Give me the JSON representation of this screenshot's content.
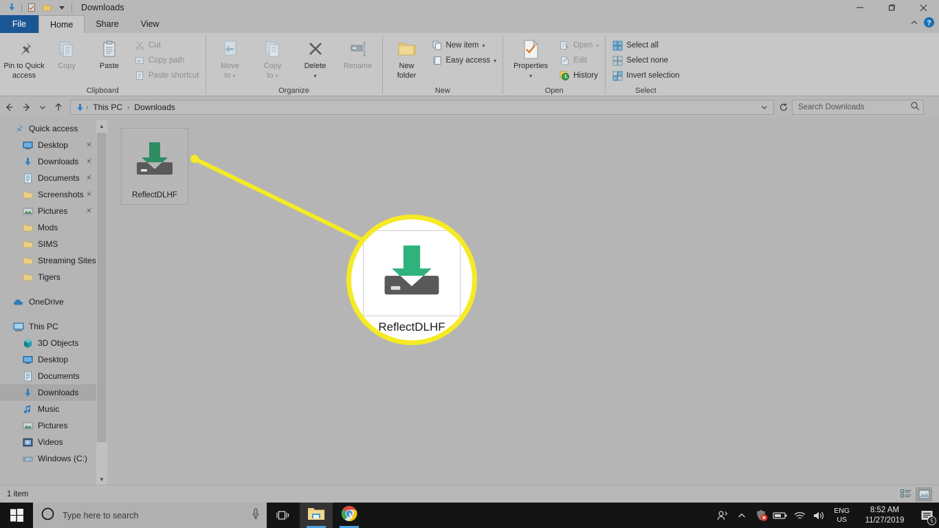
{
  "window": {
    "title": "Downloads",
    "quick_access_icons": [
      "downloads-arrow-icon",
      "properties-check-icon",
      "new-folder-icon",
      "customize-chevron-icon"
    ],
    "controls": {
      "minimize": "minimize-icon",
      "maximize": "maximize-icon",
      "close": "close-icon"
    }
  },
  "ribbon": {
    "tabs": [
      {
        "label": "File",
        "active": false,
        "kind": "file"
      },
      {
        "label": "Home",
        "active": true,
        "kind": "normal"
      },
      {
        "label": "Share",
        "active": false,
        "kind": "normal"
      },
      {
        "label": "View",
        "active": false,
        "kind": "normal"
      }
    ],
    "collapse_icon": "chevron-up-icon",
    "help_icon": "help-icon",
    "groups": [
      {
        "label": "Clipboard",
        "big_buttons": [
          {
            "label": "Pin to Quick\naccess",
            "label_line1": "Pin to Quick",
            "label_line2": "access",
            "icon": "pin-icon",
            "disabled": false
          },
          {
            "label": "Copy",
            "label_line1": "Copy",
            "label_line2": "",
            "icon": "copy-icon",
            "disabled": true
          },
          {
            "label": "Paste",
            "label_line1": "Paste",
            "label_line2": "",
            "icon": "paste-icon",
            "disabled": false
          }
        ],
        "small_buttons": [
          {
            "label": "Cut",
            "icon": "scissors-icon",
            "disabled": true,
            "caret": false
          },
          {
            "label": "Copy path",
            "icon": "copy-path-icon",
            "disabled": true,
            "caret": false
          },
          {
            "label": "Paste shortcut",
            "icon": "paste-shortcut-icon",
            "disabled": true,
            "caret": false
          }
        ]
      },
      {
        "label": "Organize",
        "big_buttons": [
          {
            "label_line1": "Move",
            "label_line2": "to",
            "icon": "move-to-icon",
            "disabled": true,
            "caret": true
          },
          {
            "label_line1": "Copy",
            "label_line2": "to",
            "icon": "copy-to-icon",
            "disabled": true,
            "caret": true
          },
          {
            "label_line1": "Delete",
            "label_line2": "",
            "icon": "delete-x-icon",
            "disabled": false,
            "caret": true
          },
          {
            "label_line1": "Rename",
            "label_line2": "",
            "icon": "rename-icon",
            "disabled": true,
            "caret": false
          }
        ],
        "small_buttons": []
      },
      {
        "label": "New",
        "big_buttons": [
          {
            "label_line1": "New",
            "label_line2": "folder",
            "icon": "new-folder-icon",
            "disabled": false,
            "caret": false
          }
        ],
        "small_buttons": [
          {
            "label": "New item",
            "icon": "new-item-icon",
            "disabled": false,
            "caret": true
          },
          {
            "label": "Easy access",
            "icon": "easy-access-icon",
            "disabled": false,
            "caret": true
          }
        ]
      },
      {
        "label": "Open",
        "big_buttons": [
          {
            "label_line1": "Properties",
            "label_line2": "",
            "icon": "properties-icon",
            "disabled": false,
            "caret": true
          }
        ],
        "small_buttons": [
          {
            "label": "Open",
            "icon": "open-icon",
            "disabled": true,
            "caret": true
          },
          {
            "label": "Edit",
            "icon": "edit-icon",
            "disabled": true,
            "caret": false
          },
          {
            "label": "History",
            "icon": "history-icon",
            "disabled": false,
            "caret": false
          }
        ]
      },
      {
        "label": "Select",
        "big_buttons": [],
        "small_buttons": [
          {
            "label": "Select all",
            "icon": "select-all-icon",
            "disabled": false,
            "caret": false
          },
          {
            "label": "Select none",
            "icon": "select-none-icon",
            "disabled": false,
            "caret": false
          },
          {
            "label": "Invert selection",
            "icon": "invert-selection-icon",
            "disabled": false,
            "caret": false
          }
        ]
      }
    ]
  },
  "address_bar": {
    "back_icon": "back-arrow-icon",
    "forward_icon": "forward-arrow-icon",
    "recent_icon": "chevron-down-icon",
    "up_icon": "up-arrow-icon",
    "path_icon": "downloads-arrow-icon",
    "crumbs": [
      "This PC",
      "Downloads"
    ],
    "dropdown_icon": "chevron-down-icon",
    "refresh_icon": "refresh-icon",
    "search_placeholder": "Search Downloads",
    "search_value": "",
    "search_icon": "search-icon"
  },
  "sidebar": {
    "items": [
      {
        "label": "Quick access",
        "icon": "star-pin-icon",
        "indent": 0,
        "pinned": false,
        "selected": false,
        "gap_before": false
      },
      {
        "label": "Desktop",
        "icon": "desktop-icon",
        "indent": 1,
        "pinned": true,
        "selected": false,
        "gap_before": false
      },
      {
        "label": "Downloads",
        "icon": "downloads-arrow-icon",
        "indent": 1,
        "pinned": true,
        "selected": false,
        "gap_before": false
      },
      {
        "label": "Documents",
        "icon": "documents-icon",
        "indent": 1,
        "pinned": true,
        "selected": false,
        "gap_before": false
      },
      {
        "label": "Screenshots",
        "icon": "folder-icon",
        "indent": 1,
        "pinned": true,
        "selected": false,
        "gap_before": false
      },
      {
        "label": "Pictures",
        "icon": "pictures-icon",
        "indent": 1,
        "pinned": true,
        "selected": false,
        "gap_before": false
      },
      {
        "label": "Mods",
        "icon": "folder-icon",
        "indent": 1,
        "pinned": false,
        "selected": false,
        "gap_before": false
      },
      {
        "label": "SIMS",
        "icon": "folder-icon",
        "indent": 1,
        "pinned": false,
        "selected": false,
        "gap_before": false
      },
      {
        "label": "Streaming Sites",
        "icon": "folder-icon",
        "indent": 1,
        "pinned": false,
        "selected": false,
        "gap_before": false
      },
      {
        "label": "Tigers",
        "icon": "folder-icon",
        "indent": 1,
        "pinned": false,
        "selected": false,
        "gap_before": false
      },
      {
        "label": "OneDrive",
        "icon": "cloud-icon",
        "indent": 0,
        "pinned": false,
        "selected": false,
        "gap_before": true
      },
      {
        "label": "This PC",
        "icon": "this-pc-icon",
        "indent": 0,
        "pinned": false,
        "selected": false,
        "gap_before": true
      },
      {
        "label": "3D Objects",
        "icon": "3d-objects-icon",
        "indent": 1,
        "pinned": false,
        "selected": false,
        "gap_before": false
      },
      {
        "label": "Desktop",
        "icon": "desktop-icon",
        "indent": 1,
        "pinned": false,
        "selected": false,
        "gap_before": false
      },
      {
        "label": "Documents",
        "icon": "documents-icon",
        "indent": 1,
        "pinned": false,
        "selected": false,
        "gap_before": false
      },
      {
        "label": "Downloads",
        "icon": "downloads-arrow-icon",
        "indent": 1,
        "pinned": false,
        "selected": true,
        "gap_before": false
      },
      {
        "label": "Music",
        "icon": "music-icon",
        "indent": 1,
        "pinned": false,
        "selected": false,
        "gap_before": false
      },
      {
        "label": "Pictures",
        "icon": "pictures-icon",
        "indent": 1,
        "pinned": false,
        "selected": false,
        "gap_before": false
      },
      {
        "label": "Videos",
        "icon": "videos-icon",
        "indent": 1,
        "pinned": false,
        "selected": false,
        "gap_before": false
      },
      {
        "label": "Windows (C:)",
        "icon": "drive-icon",
        "indent": 1,
        "pinned": false,
        "selected": false,
        "gap_before": false
      }
    ],
    "scroll_up_icon": "chevron-up-icon",
    "scroll_down_icon": "chevron-down-icon"
  },
  "files": [
    {
      "name": "ReflectDLHF",
      "icon": "download-file-icon"
    }
  ],
  "callout": {
    "magnified_name": "ReflectDLHF",
    "magnified_icon": "download-file-icon",
    "highlight_color": "#f5ea25"
  },
  "status_bar": {
    "item_count": "1 item",
    "view_buttons": [
      {
        "name": "details-view",
        "active": false
      },
      {
        "name": "large-icons-view",
        "active": true
      }
    ]
  },
  "taskbar": {
    "start_icon": "windows-start-icon",
    "search_placeholder": "Type here to search",
    "search_value": "",
    "cortana_icon": "cortana-circle-icon",
    "mic_icon": "microphone-icon",
    "task_view_icon": "task-view-icon",
    "apps": [
      {
        "name": "file-explorer",
        "icon": "file-explorer-icon",
        "active": true
      },
      {
        "name": "google-chrome",
        "icon": "chrome-icon",
        "active": false
      }
    ],
    "tray": {
      "people_icon": "people-icon",
      "overflow_icon": "chevron-up-icon",
      "antivirus_icon": "antivirus-alert-icon",
      "battery_icon": "battery-icon",
      "wifi_icon": "wifi-icon",
      "volume_icon": "volume-icon",
      "language_line1": "ENG",
      "language_line2": "US",
      "time": "8:52 AM",
      "date": "11/27/2019",
      "notification_icon": "action-center-icon",
      "notification_count": "5"
    }
  }
}
